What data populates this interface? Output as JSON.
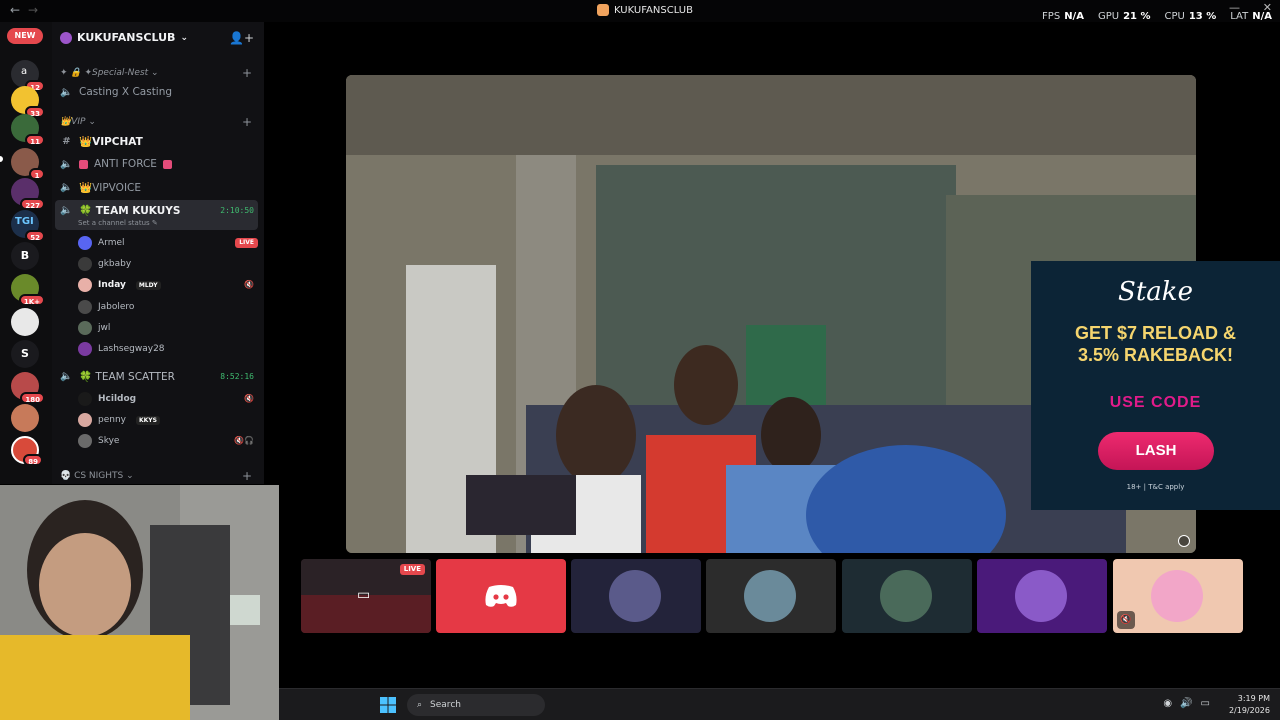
{
  "window": {
    "title": "KUKUFANSCLUB",
    "back": "←",
    "forward": "→",
    "perf": [
      {
        "label": "FPS",
        "value": "N/A"
      },
      {
        "label": "GPU",
        "value": "21 %"
      },
      {
        "label": "CPU",
        "value": "13 %"
      },
      {
        "label": "LAT",
        "value": "N/A"
      }
    ]
  },
  "rail": {
    "new_label": "NEW",
    "servers": [
      {
        "badge": "12"
      },
      {
        "badge": "33"
      },
      {
        "badge": "11"
      },
      {
        "badge": "1"
      },
      {
        "badge": "227"
      },
      {
        "badge": "52"
      },
      {
        "letter": "B"
      },
      {
        "badge": "1K+"
      },
      {
        "badge": ""
      },
      {
        "letter": "S"
      },
      {
        "badge": "180"
      },
      {
        "badge": ""
      },
      {
        "badge": "89"
      }
    ]
  },
  "sidebar": {
    "server_name": "KUKUFANSCLUB",
    "categories": {
      "special_nest": "✦ 🔒 ✦Special-Nest",
      "vip": "👑VIP",
      "cs_nights": "💀 CS NIGHTS"
    },
    "channels": {
      "casting": "Casting X Casting",
      "vipchat": "👑VIPCHAT",
      "antiforce": "ANTI FORCE",
      "vipvoice": "👑VIPVOICE",
      "team_kukuys": "🍀 TEAM KUKUYS",
      "team_kukuys_timer": "2:10:50",
      "team_kukuys_status": "Set a channel status",
      "team_scatter": "🍀 TEAM SCATTER",
      "team_scatter_timer": "8:52:16"
    },
    "members_kukuys": [
      {
        "name": "Armel",
        "live": "LIVE"
      },
      {
        "name": "gkbaby"
      },
      {
        "name": "Inday",
        "tag": "MLDY"
      },
      {
        "name": "Jabolero"
      },
      {
        "name": "jwl"
      },
      {
        "name": "Lashsegway28"
      }
    ],
    "members_scatter": [
      {
        "name": "Hcildog"
      },
      {
        "name": "penny",
        "tag": "KKYS"
      },
      {
        "name": "Skye"
      }
    ]
  },
  "ad": {
    "logo": "Stake",
    "headline_1": "GET $7 RELOAD &",
    "headline_2": "3.5% RAKEBACK!",
    "code_label": "USE CODE",
    "button": "LASH",
    "fine_print": "18+ | T&C apply"
  },
  "tiles": {
    "live_label": "LIVE"
  },
  "taskbar": {
    "search_placeholder": "Search",
    "time": "3:19 PM",
    "date": "2/19/2026"
  },
  "colors": {
    "accent_green": "#3fba6f",
    "live_red": "#e5484d",
    "discord_tile": "#e53945",
    "ad_yellow": "#f5d56e",
    "ad_pink": "#e11b8a"
  }
}
